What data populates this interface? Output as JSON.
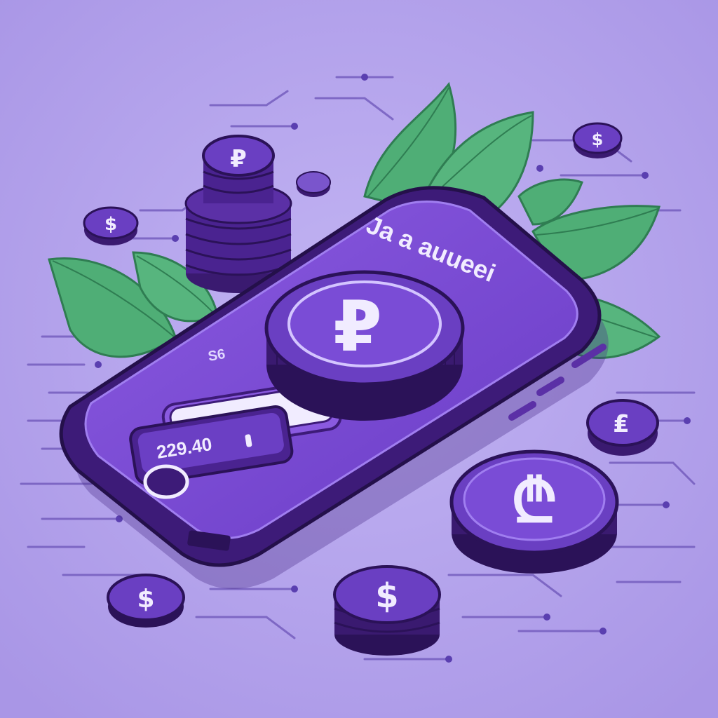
{
  "colors": {
    "background": "#b3a3ec",
    "circuit_line": "#6c54b8",
    "phone_body": "#3d1b78",
    "phone_screen": "#7a4cd6",
    "coin_face": "#6a3fc2",
    "coin_edge": "#3a1a70",
    "coin_symbol": "#f1ecff",
    "leaf": "#4fae76",
    "leaf_dark": "#2f7d52"
  },
  "phone": {
    "app_title": "Ja a auueei",
    "small_label": "S6",
    "amount_text": "229.40",
    "input_icon": "text-cursor-icon",
    "home_button_icon": "home-button-icon"
  },
  "coins": {
    "main_symbol": "₽",
    "big_symbol": "₾",
    "stack_symbol": "₽",
    "small_symbols": [
      "$",
      "$",
      "$",
      "$",
      "₤"
    ]
  },
  "decor": {
    "leaf_icon": "leaf-icon",
    "coin_icon": "coin-icon"
  }
}
